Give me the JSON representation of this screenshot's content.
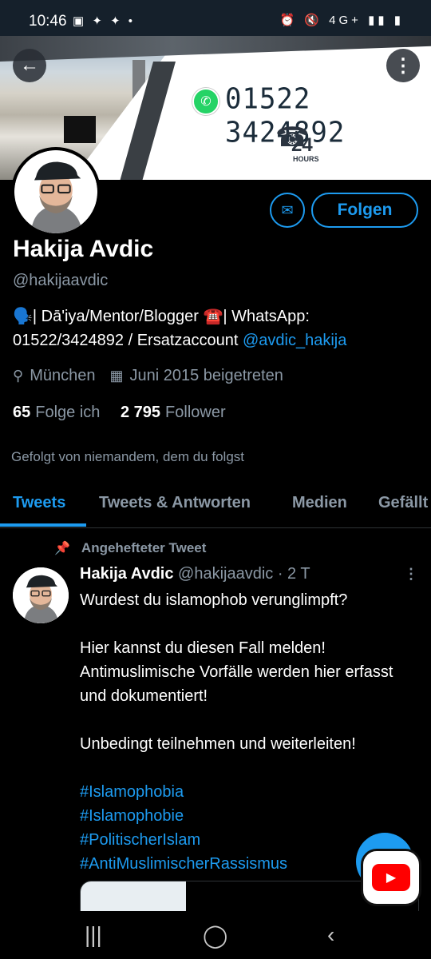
{
  "status_bar": {
    "time": "10:46",
    "left_icons": "▣ ✦ ✦ •",
    "right_icons": "⏰ 🔇 4G+ ▮▮ ▮"
  },
  "banner": {
    "phone": "01522 3424892",
    "hours_number": "24",
    "hours_label": "HOURS"
  },
  "profile": {
    "follow_label": "Folgen",
    "name": "Hakija Avdic",
    "handle": "@hakijaavdic",
    "bio_text": "🗣️| Dā'iya/Mentor/Blogger ☎️| WhatsApp: 01522/3424892 / Ersatzaccount ",
    "bio_mention": "@avdic_hakija",
    "location": "München",
    "joined": "Juni 2015 beigetreten",
    "following_count": "65",
    "following_label": "Folge ich",
    "followers_count": "2 795",
    "followers_label": "Follower",
    "followed_by": "Gefolgt von niemandem, dem du folgst"
  },
  "tabs": [
    "Tweets",
    "Tweets & Antworten",
    "Medien",
    "Gefällt"
  ],
  "tweet": {
    "pinned_label": "Angehefteter Tweet",
    "author": "Hakija Avdic",
    "handle_time": "@hakijaavdic · 2 T",
    "line1": "Wurdest du islamophob verunglimpft?",
    "line2": "Hier kannst du diesen Fall melden! Antimuslimische Vorfälle werden hier erfasst und dokumentiert!",
    "line3": "Unbedingt teilnehmen und weiterleiten!",
    "hashtags": [
      "#Islamophobia",
      "#Islamophobie",
      "#PolitischerIslam",
      "#AntiMuslimischerRassismus"
    ]
  },
  "icons": {
    "back": "back-arrow-icon",
    "more": "more-vertical-icon",
    "message": "envelope-icon",
    "location": "location-pin-icon",
    "calendar": "calendar-icon",
    "pin": "pin-icon",
    "youtube": "youtube-icon"
  },
  "colors": {
    "accent": "#1d9bf0",
    "background": "#000000",
    "muted": "#8b98a5"
  }
}
